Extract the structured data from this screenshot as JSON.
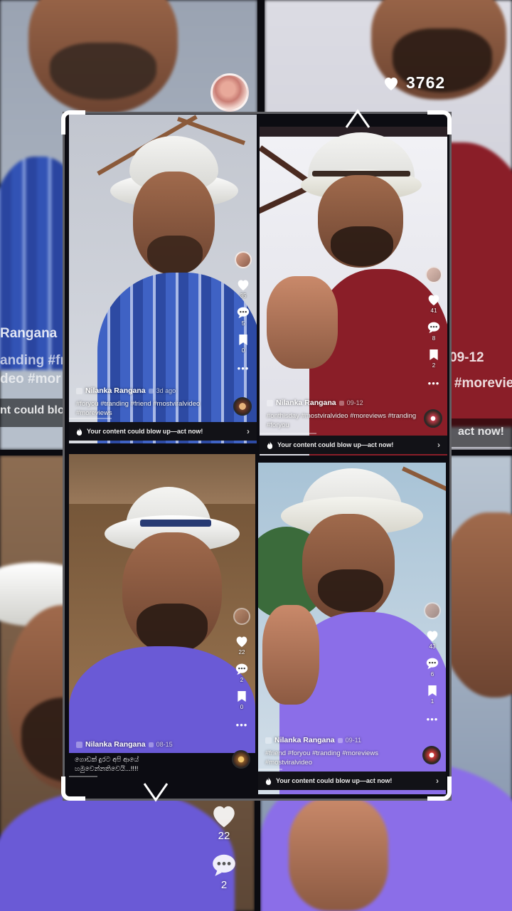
{
  "overlay": {
    "top_like_count": "3762",
    "side_like_count": "22",
    "side_comment_count": "2",
    "icons": {
      "heart": "heart-icon",
      "comment": "comment-icon",
      "chevron_up": "chevron-up-icon",
      "chevron_down": "chevron-down-icon"
    }
  },
  "background": {
    "tl_name": "Rangana",
    "tl_tags_1": "anding #fri",
    "tl_tags_2": "deo #mor",
    "tl_promo": "nt could blo",
    "tr_date": "09-12",
    "tr_tags": "o #moreviews",
    "tr_promo": "act now!"
  },
  "tiles": [
    {
      "author": "Nilanka Rangana",
      "date": "3d ago",
      "tags": "#foryou #tranding #friend #mostviralvideo #moreviews",
      "likes": "35",
      "comments": "5",
      "saves": "0",
      "more": "•••",
      "promo": "Your content could blow up—act now!",
      "promo_arrow": "›"
    },
    {
      "author": "Nilanka Rangana",
      "date": "09-12",
      "tags": "#onthisday #mostviralvideo #moreviews #tranding #foryou",
      "likes": "41",
      "comments": "8",
      "saves": "2",
      "more": "•••",
      "promo": "Your content could blow up—act now!",
      "promo_arrow": "›"
    },
    {
      "author": "Nilanka Rangana",
      "date": "08-15",
      "caption": "ගොඩක් දුරට අපි ආයේ හමුවෙන්නතිවෙයි...!!!!",
      "likes": "22",
      "comments": "2",
      "saves": "0",
      "more": "•••"
    },
    {
      "author": "Nilanka Rangana",
      "date": "09-11",
      "tags": "#friend #foryou #tranding #moreviews #mostviralvideo",
      "likes": "43",
      "comments": "6",
      "saves": "1",
      "more": "•••",
      "promo": "Your content could blow up—act now!",
      "promo_arrow": "›"
    }
  ],
  "colors": {
    "tile1_wall": "#c9ccd4",
    "tile1_shirt": "#3f62c4",
    "tile2_wall": "#e9e9ee",
    "tile2_shirt": "#8a1e28",
    "tile3_wall": "#7a5a3c",
    "tile3_shirt": "#6a5ad6",
    "tile4_wall": "#8cb0c9",
    "tile4_shirt": "#8b6ee8",
    "frame_corner": "#ffffff"
  }
}
